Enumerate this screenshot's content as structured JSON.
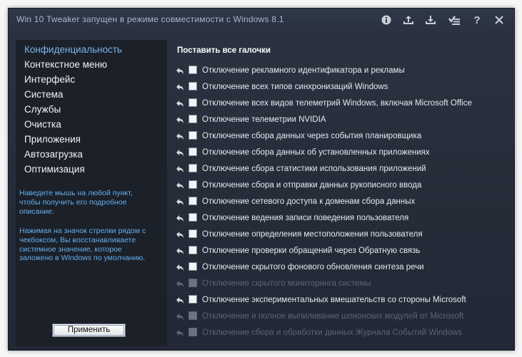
{
  "title": "Win 10 Tweaker запущен в режиме совместимости с Windows 8.1",
  "titlebar_icons": [
    "info-icon",
    "upload-icon",
    "download-icon",
    "list-check-icon",
    "help-icon",
    "close-icon"
  ],
  "help_glyph": "?",
  "sidebar": {
    "items": [
      {
        "label": "Конфиденциальность",
        "active": true
      },
      {
        "label": "Контекстное меню"
      },
      {
        "label": "Интерфейс"
      },
      {
        "label": "Система"
      },
      {
        "label": "Службы"
      },
      {
        "label": "Очистка"
      },
      {
        "label": "Приложения"
      },
      {
        "label": "Автозагрузка"
      },
      {
        "label": "Оптимизация"
      }
    ],
    "hint1": "Наведите мышь на любой пункт, чтобы получить его подробное описание.",
    "hint2": "Нажимая на значок стрелки рядом с чекбоксом, Вы восстанавливаете системное значение, которое заложено в Windows по умолчанию.",
    "apply_label": "Применить"
  },
  "main": {
    "check_all_label": "Поставить все галочки",
    "options": [
      {
        "label": "Отключение рекламного идентификатора и рекламы",
        "enabled": true
      },
      {
        "label": "Отключение всех типов синхронизаций Windows",
        "enabled": true
      },
      {
        "label": "Отключение всех видов телеметрий Windows, включая Microsoft Office",
        "enabled": true
      },
      {
        "label": "Отключение телеметрии NVIDIA",
        "enabled": true
      },
      {
        "label": "Отключение сбора данных через события планировщика",
        "enabled": true
      },
      {
        "label": "Отключение сбора данных об установленных приложениях",
        "enabled": true
      },
      {
        "label": "Отключение сбора статистики использования приложений",
        "enabled": true
      },
      {
        "label": "Отключение сбора и отправки данных рукописного ввода",
        "enabled": true
      },
      {
        "label": "Отключение сетевого доступа к доменам сбора данных",
        "enabled": true
      },
      {
        "label": "Отключение ведения записи поведения пользователя",
        "enabled": true
      },
      {
        "label": "Отключение определения местоположения пользователя",
        "enabled": true
      },
      {
        "label": "Отключение проверки обращений через Обратную связь",
        "enabled": true
      },
      {
        "label": "Отключение скрытого фонового обновления синтеза речи",
        "enabled": true
      },
      {
        "label": "Отключение скрытого мониторинга системы",
        "enabled": false
      },
      {
        "label": "Отключение экспериментальных вмешательств со стороны Microsoft",
        "enabled": true
      },
      {
        "label": "Отключение и полное выпиливание шпионских модулей от Microsoft",
        "enabled": false
      },
      {
        "label": "Отключение сбора и обработки данных Журнала Событий Windows",
        "enabled": false
      }
    ]
  },
  "colors": {
    "window_bg": "#252c38",
    "sidebar_bg": "#1b2029",
    "accent": "#7fb5ea",
    "hint": "#66b0ee",
    "disabled_text": "#5b6572"
  }
}
